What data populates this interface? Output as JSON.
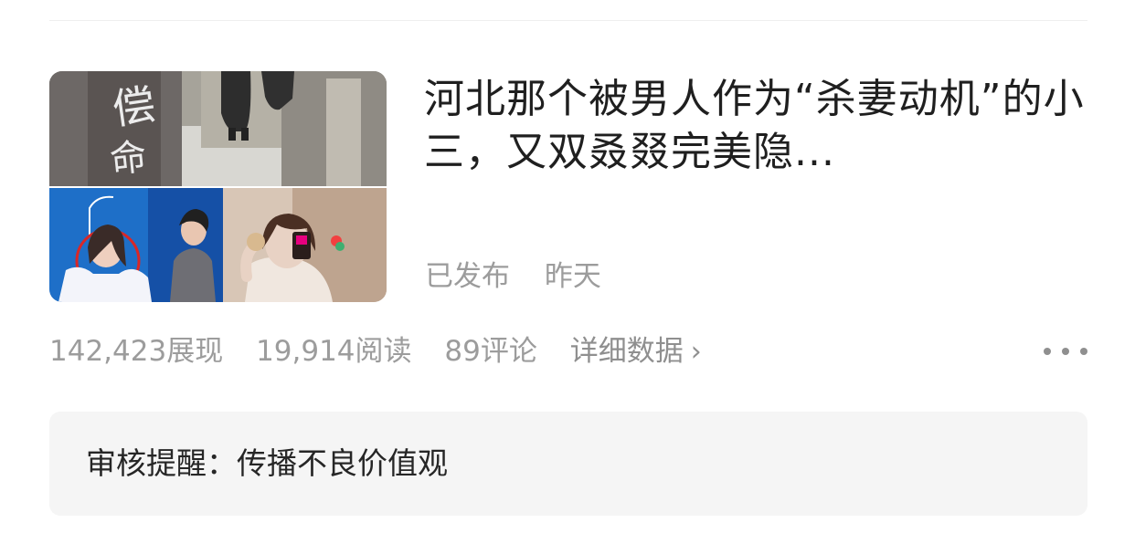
{
  "article": {
    "title": "河北那个被男人作为“杀妻动机”的小三，又双叒叕完美隐...",
    "publish_status": "已发布",
    "publish_time": "昨天",
    "thumbnail_icon": "article-thumbnail"
  },
  "stats": {
    "impressions": "142,423展现",
    "reads": "19,914阅读",
    "comments": "89评论",
    "detail_link": "详细数据",
    "chevron": "›",
    "more_icon": "more-horizontal-icon"
  },
  "review": {
    "text": "审核提醒：传播不良价值观"
  }
}
